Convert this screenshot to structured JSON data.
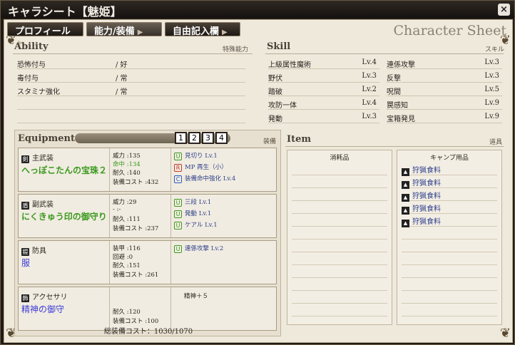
{
  "window": {
    "title": "キャラシート【魅姫】",
    "close": "×"
  },
  "tabs": [
    {
      "label": "プロフィール",
      "arrow": "▶"
    },
    {
      "label": "能力/装備",
      "arrow": "▶"
    },
    {
      "label": "自由記入欄",
      "arrow": "▶"
    }
  ],
  "sheet_title": "Character Sheet",
  "ability": {
    "heading": "Ability",
    "sub": "特殊能力",
    "rows": [
      {
        "name": "恐怖付与",
        "value": "/ 好"
      },
      {
        "name": "毒付与",
        "value": "/ 常"
      },
      {
        "name": "スタミナ強化",
        "value": "/ 常"
      }
    ]
  },
  "skill": {
    "heading": "Skill",
    "sub": "スキル",
    "left": [
      {
        "name": "上級属性魔術",
        "lv": "Lv.4"
      },
      {
        "name": "野伏",
        "lv": "Lv.3"
      },
      {
        "name": "踏破",
        "lv": "Lv.2"
      },
      {
        "name": "攻防一体",
        "lv": "Lv.4"
      },
      {
        "name": "発動",
        "lv": "Lv.3"
      }
    ],
    "right": [
      {
        "name": "連係攻撃",
        "lv": "Lv.3"
      },
      {
        "name": "反撃",
        "lv": "Lv.3"
      },
      {
        "name": "呪間",
        "lv": "Lv.5"
      },
      {
        "name": "罠感知",
        "lv": "Lv.9"
      },
      {
        "name": "宝箱発見",
        "lv": "Lv.9"
      }
    ]
  },
  "equipment": {
    "heading": "Equipment",
    "sub": "装備",
    "slots": [
      "1",
      "2",
      "3",
      "4"
    ],
    "items": [
      {
        "type": "主武装",
        "icon": "剣",
        "name": "へっぽこたんの宝珠２",
        "name_color": "#3a9a1e",
        "stats": [
          "威力 :135",
          "命中 :134",
          "耐久 :140",
          "装備コスト :432"
        ],
        "skills": [
          {
            "badge": "U",
            "color": "#3a9a1e",
            "text": "見切り Lv.1"
          },
          {
            "badge": "R",
            "color": "#c0392b",
            "text": "MP 再生（小）"
          },
          {
            "badge": "C",
            "color": "#2a5ac0",
            "text": "装備命中強化 Lv.4"
          }
        ]
      },
      {
        "type": "副武装",
        "icon": "盾",
        "name": "にくきゅう印の御守り",
        "name_color": "#3a9a1e",
        "stats": [
          "威力 :29",
          "- :-",
          "耐久 :111",
          "装備コスト :237"
        ],
        "skills": [
          {
            "badge": "U",
            "color": "#3a9a1e",
            "text": "三段 Lv.1"
          },
          {
            "badge": "U",
            "color": "#3a9a1e",
            "text": "発動 Lv.1"
          },
          {
            "badge": "U",
            "color": "#3a9a1e",
            "text": "ケアル Lv.1"
          }
        ]
      },
      {
        "type": "防具",
        "icon": "鎧",
        "name": "服",
        "name_color": "#3b3bd6",
        "stats": [
          "装甲 :116",
          "回避 :0",
          "耐久 :151",
          "装備コスト :261"
        ],
        "skills": [
          {
            "badge": "U",
            "color": "#3a9a1e",
            "text": "連係攻撃 Lv.2"
          }
        ]
      },
      {
        "type": "アクセサリ",
        "icon": "飾",
        "name": "精神の御守",
        "name_color": "#3b3bd6",
        "stats": [
          "",
          "",
          "耐久 :120",
          "装備コスト :100"
        ],
        "bonus": "精神＋５",
        "skills": []
      }
    ],
    "total": "総装備コスト：1030/1070"
  },
  "item": {
    "heading": "Item",
    "sub": "道具",
    "consumables_label": "消耗品",
    "camp_label": "キャンプ用品",
    "camp_items": [
      "狩猟食料",
      "狩猟食料",
      "狩猟食料",
      "狩猟食料",
      "狩猟食料"
    ]
  }
}
